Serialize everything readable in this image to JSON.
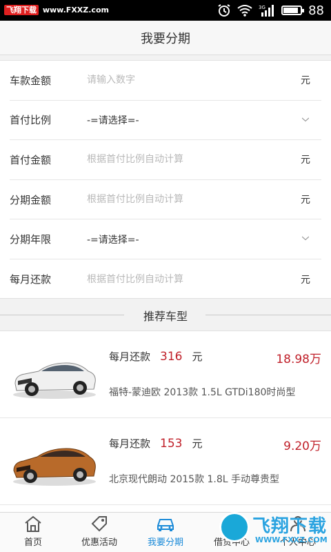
{
  "status_bar": {
    "site_badge": "飞翔下载",
    "site_url": "www.FXXZ.com",
    "battery_level": "88",
    "battery_fraction": 0.88,
    "icons": [
      "alarm-icon",
      "wifi-icon",
      "signal-3g-icon",
      "battery-icon"
    ]
  },
  "header": {
    "title": "我要分期"
  },
  "form": {
    "rows": [
      {
        "label": "车款金额",
        "placeholder": "请输入数字",
        "unit": "元",
        "kind": "input"
      },
      {
        "label": "首付比例",
        "value": "-=请选择=-",
        "kind": "select"
      },
      {
        "label": "首付金额",
        "placeholder": "根据首付比例自动计算",
        "unit": "元",
        "kind": "input"
      },
      {
        "label": "分期金额",
        "placeholder": "根据首付比例自动计算",
        "unit": "元",
        "kind": "input"
      },
      {
        "label": "分期年限",
        "value": "-=请选择=-",
        "kind": "select"
      },
      {
        "label": "每月还款",
        "placeholder": "根据首付比例自动计算",
        "unit": "元",
        "kind": "input"
      }
    ]
  },
  "section": {
    "title": "推荐车型"
  },
  "cars": [
    {
      "pay_label": "每月还款",
      "pay_amount": "316",
      "pay_unit": "元",
      "price": "18.98万",
      "name": "福特-蒙迪欧 2013款 1.5L GTDi180时尚型",
      "body_color": "#f0f0f0"
    },
    {
      "pay_label": "每月还款",
      "pay_amount": "153",
      "pay_unit": "元",
      "price": "9.20万",
      "name": "北京现代朗动  2015款 1.8L 手动尊贵型",
      "body_color": "#b86a2a"
    }
  ],
  "tabs": [
    {
      "label": "首页",
      "icon": "home-icon",
      "active": false
    },
    {
      "label": "优惠活动",
      "icon": "tag-icon",
      "active": false
    },
    {
      "label": "我要分期",
      "icon": "car-icon",
      "active": true
    },
    {
      "label": "借贷中心",
      "icon": "loan-icon",
      "active": false
    },
    {
      "label": "个人中心",
      "icon": "user-icon",
      "active": false
    }
  ],
  "watermark": {
    "text": "飞翔下载",
    "url": "WWW.FXXZ.COM"
  },
  "colors": {
    "accent": "#1a8ad8",
    "price": "#c0202a",
    "watermark": "#2ba3e0"
  }
}
